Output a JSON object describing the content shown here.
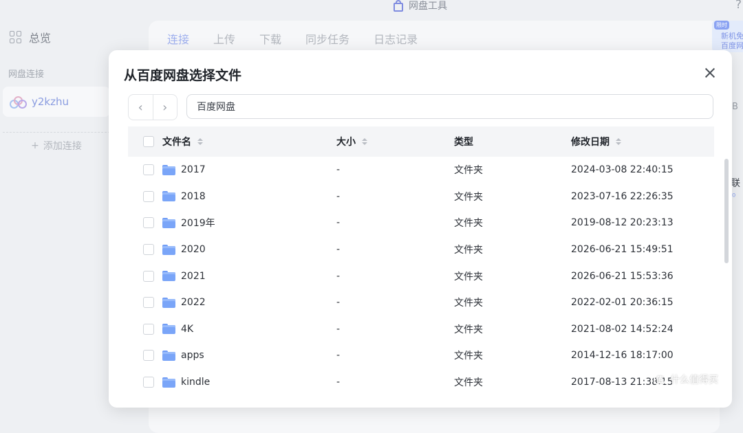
{
  "app": {
    "title": "网盘工具",
    "help": "?"
  },
  "sidebar": {
    "overview_label": "总览",
    "section_label": "网盘连接",
    "account_name": "y2kzhu",
    "add_connection_label": "添加连接"
  },
  "main": {
    "tabs": [
      {
        "label": "连接"
      },
      {
        "label": "上传"
      },
      {
        "label": "下载"
      },
      {
        "label": "同步任务"
      },
      {
        "label": "日志记录"
      }
    ]
  },
  "promo": {
    "badge": "限时",
    "line1": "新机免",
    "line2": "百度网"
  },
  "right_fragments": {
    "b": "B",
    "lian": "联",
    "dot": "⁰"
  },
  "modal": {
    "title": "从百度网盘选择文件",
    "path_value": "百度网盘",
    "columns": {
      "name": "文件名",
      "size": "大小",
      "type": "类型",
      "date": "修改日期"
    },
    "rows": [
      {
        "name": "2017",
        "size": "-",
        "type": "文件夹",
        "date": "2024-03-08 22:40:15"
      },
      {
        "name": "2018",
        "size": "-",
        "type": "文件夹",
        "date": "2023-07-16 22:26:35"
      },
      {
        "name": "2019年",
        "size": "-",
        "type": "文件夹",
        "date": "2019-08-12 20:23:13"
      },
      {
        "name": "2020",
        "size": "-",
        "type": "文件夹",
        "date": "2026-06-21 15:49:51"
      },
      {
        "name": "2021",
        "size": "-",
        "type": "文件夹",
        "date": "2026-06-21 15:53:36"
      },
      {
        "name": "2022",
        "size": "-",
        "type": "文件夹",
        "date": "2022-02-01 20:36:15"
      },
      {
        "name": "4K",
        "size": "-",
        "type": "文件夹",
        "date": "2021-08-02 14:52:24"
      },
      {
        "name": "apps",
        "size": "-",
        "type": "文件夹",
        "date": "2014-12-16 18:17:00"
      },
      {
        "name": "kindle",
        "size": "-",
        "type": "文件夹",
        "date": "2017-08-13 21:38:15"
      }
    ]
  },
  "watermark": {
    "icon": "值",
    "text": "什么值得买"
  }
}
